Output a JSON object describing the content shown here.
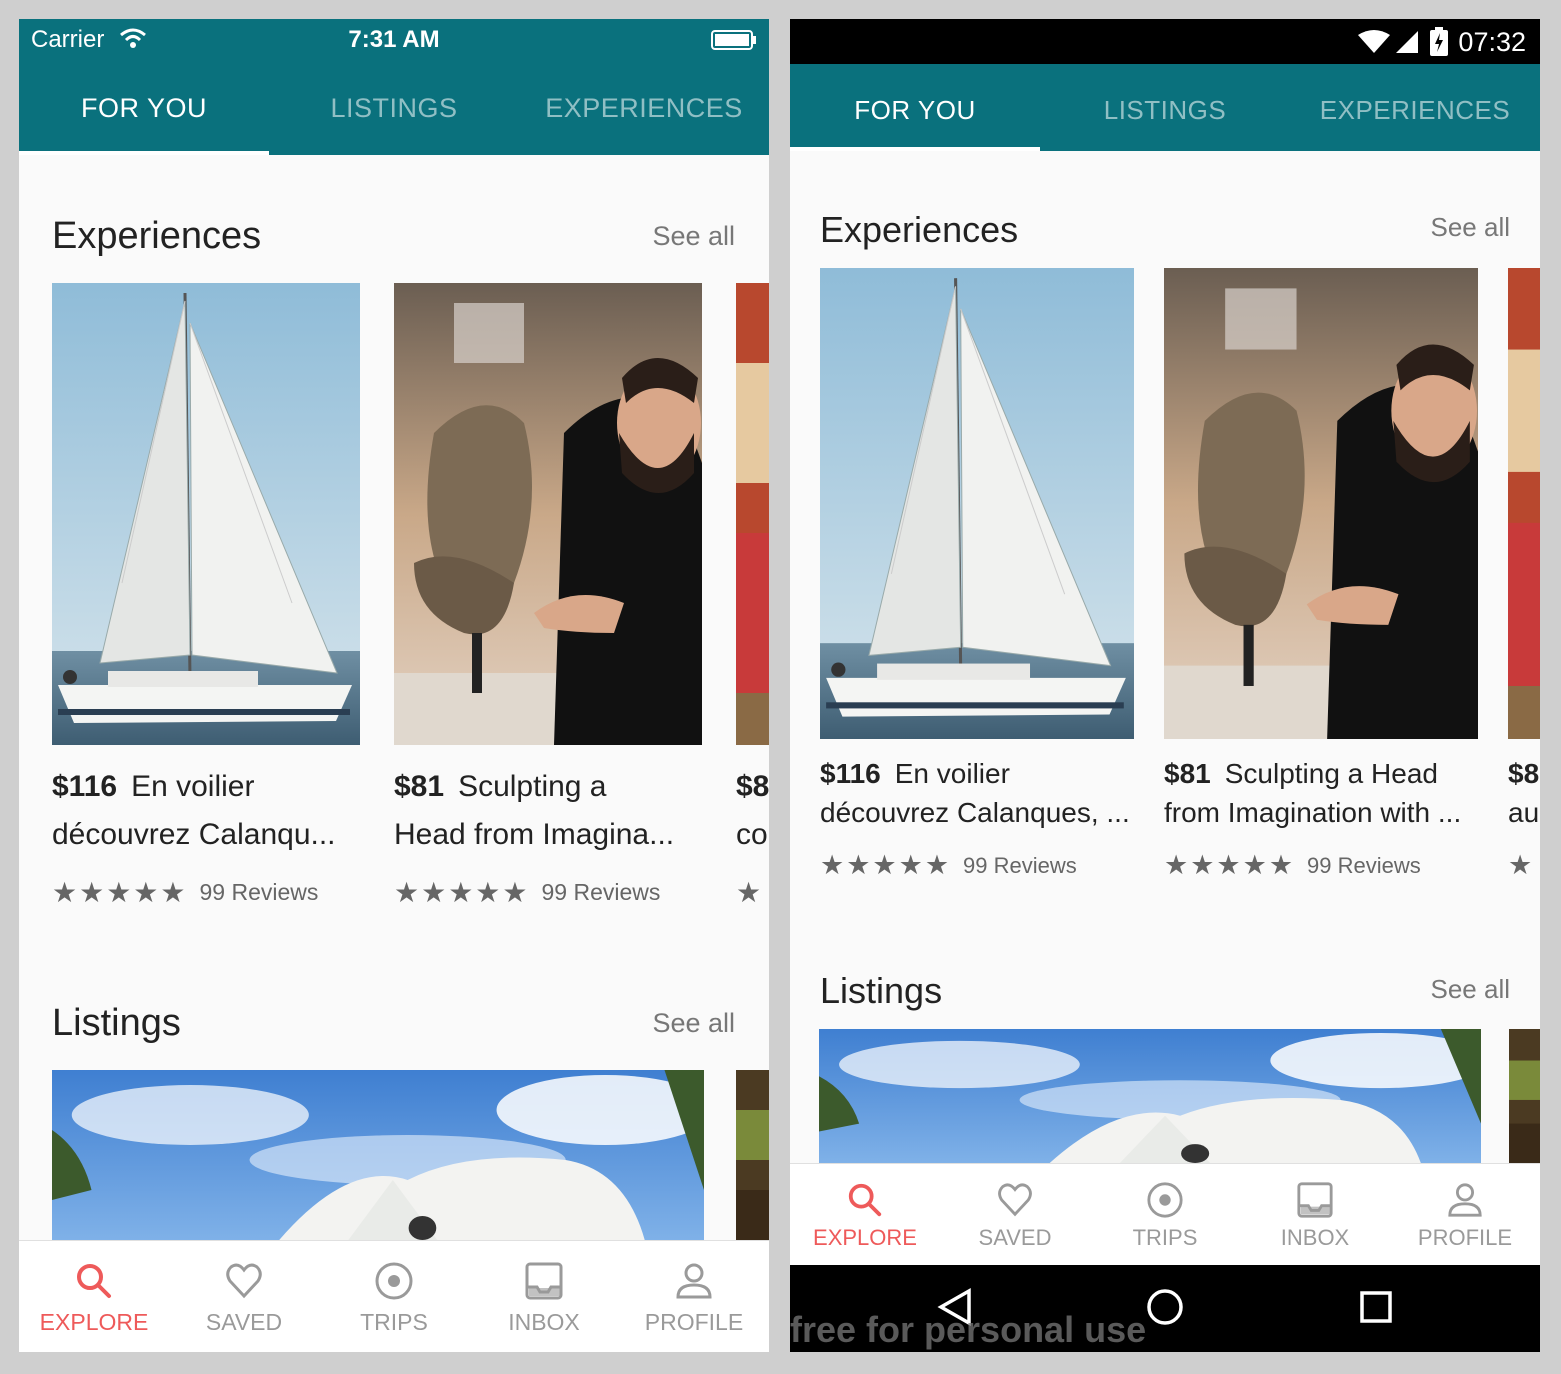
{
  "ios": {
    "status": {
      "carrier": "Carrier",
      "time": "7:31 AM"
    },
    "tabs": [
      "FOR YOU",
      "LISTINGS",
      "EXPERIENCES"
    ],
    "experiences": {
      "title": "Experiences",
      "see_all": "See all",
      "cards": [
        {
          "price": "$116",
          "line1": "En voilier",
          "line2": "découvrez Calanqu...",
          "stars": "★★★★★",
          "reviews": "99 Reviews"
        },
        {
          "price": "$81",
          "line1": "Sculpting a",
          "line2": "Head from Imagina...",
          "stars": "★★★★★",
          "reviews": "99 Reviews"
        },
        {
          "price": "$8",
          "line2": "co",
          "stars": "★"
        }
      ]
    },
    "listings": {
      "title": "Listings",
      "see_all": "See all"
    },
    "nav": [
      "EXPLORE",
      "SAVED",
      "TRIPS",
      "INBOX",
      "PROFILE"
    ]
  },
  "android": {
    "status": {
      "time": "07:32"
    },
    "tabs": [
      "FOR YOU",
      "LISTINGS",
      "EXPERIENCES"
    ],
    "experiences": {
      "title": "Experiences",
      "see_all": "See all",
      "cards": [
        {
          "price": "$116",
          "line1": "En voilier",
          "line2": "découvrez Calanques, ...",
          "stars": "★★★★★",
          "reviews": "99 Reviews"
        },
        {
          "price": "$81",
          "line1": "Sculpting a Head",
          "line2": "from Imagination with ...",
          "stars": "★★★★★",
          "reviews": "99 Reviews"
        },
        {
          "price": "$8",
          "line2": "au",
          "stars": "★"
        }
      ]
    },
    "listings": {
      "title": "Listings",
      "see_all": "See all"
    },
    "nav": [
      "EXPLORE",
      "SAVED",
      "TRIPS",
      "INBOX",
      "PROFILE"
    ],
    "watermark": "free for personal use"
  },
  "colors": {
    "header": "#0a717d",
    "active_nav": "#ee5a5a",
    "inactive_nav": "#9a9a9a"
  }
}
